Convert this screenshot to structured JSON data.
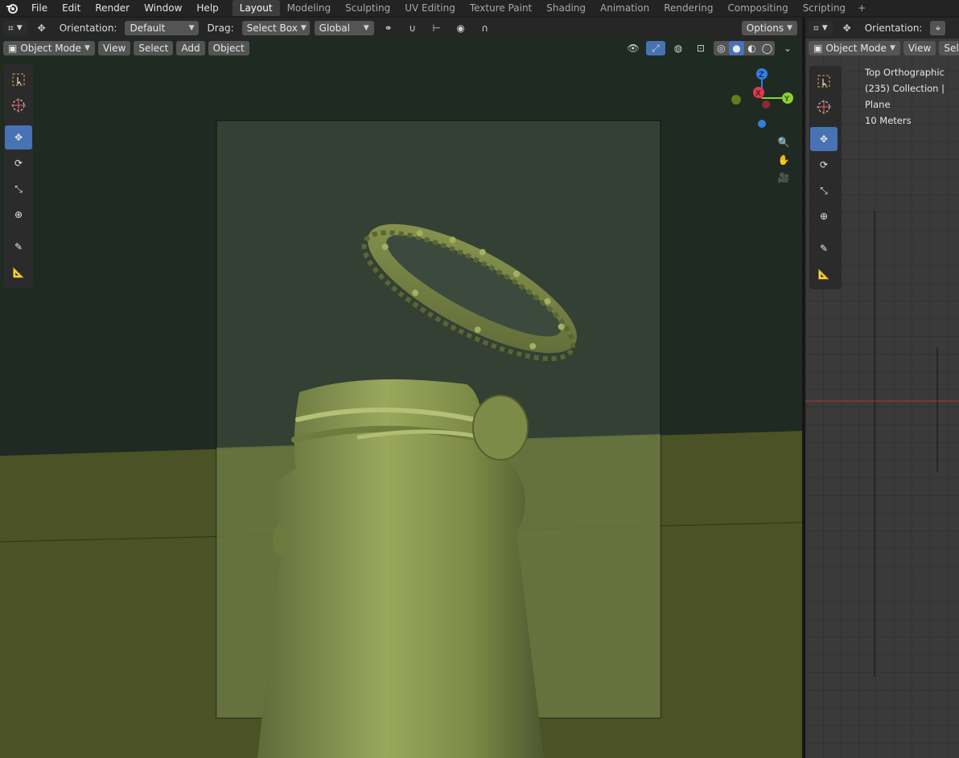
{
  "menu": [
    "File",
    "Edit",
    "Render",
    "Window",
    "Help"
  ],
  "workspaces": {
    "items": [
      "Layout",
      "Modeling",
      "Sculpting",
      "UV Editing",
      "Texture Paint",
      "Shading",
      "Animation",
      "Rendering",
      "Compositing",
      "Scripting"
    ],
    "active": "Layout"
  },
  "toolheader": {
    "orientation_label": "Orientation:",
    "orientation_value": "Default",
    "drag_label": "Drag:",
    "drag_value": "Select Box",
    "transform_space": "Global",
    "options": "Options"
  },
  "viewport_header": {
    "mode": "Object Mode",
    "menus": [
      "View",
      "Select",
      "Add",
      "Object"
    ]
  },
  "right_panel": {
    "orientation_label": "Orientation:",
    "mode": "Object Mode",
    "view": "View",
    "select": "Sele",
    "overlay": {
      "view_name": "Top Orthographic",
      "collection": "(235) Collection | Plane",
      "scale": "10 Meters"
    }
  },
  "gizmo": {
    "z": "Z",
    "x": "X",
    "y": "Y"
  },
  "colors": {
    "accent": "#4772b3",
    "axis_x": "#e0394e",
    "axis_y": "#8bd130",
    "axis_z": "#2f80e0",
    "bottle": "#8a9a52"
  }
}
